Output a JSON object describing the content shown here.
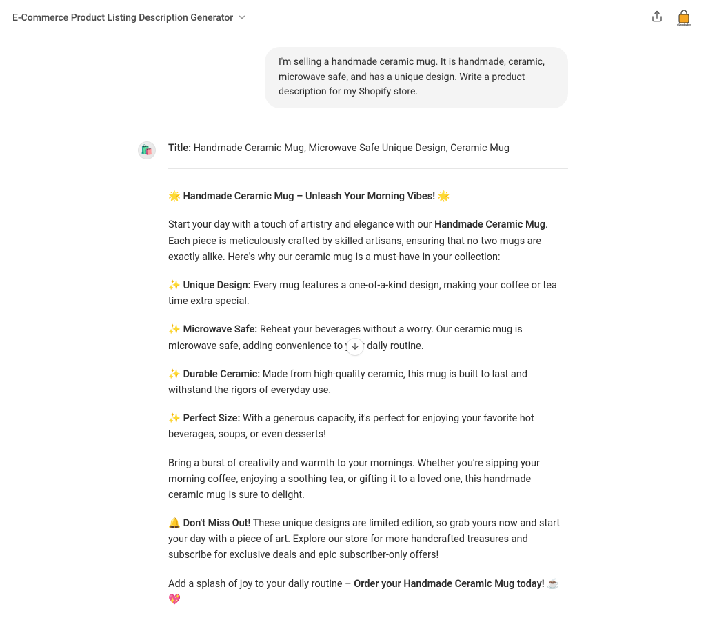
{
  "header": {
    "title": "E-Commerce Product Listing Description Generator",
    "integration_label": "eShopBuddy"
  },
  "user_message": "I'm selling a handmade ceramic mug. It is handmade, ceramic, microwave safe, and has a unique design. Write a product description for my Shopify store.",
  "assistant": {
    "title_label": "Title:",
    "title_value": "Handmade Ceramic Mug, Microwave Safe Unique Design, Ceramic Mug",
    "headline": "🌟 Handmade Ceramic Mug – Unleash Your Morning Vibes! 🌟",
    "intro_pre": "Start your day with a touch of artistry and elegance with our ",
    "intro_bold": "Handmade Ceramic Mug",
    "intro_post": ". Each piece is meticulously crafted by skilled artisans, ensuring that no two mugs are exactly alike. Here's why our ceramic mug is a must-have in your collection:",
    "feat1_label": "✨ Unique Design:",
    "feat1_text": " Every mug features a one-of-a-kind design, making your coffee or tea time extra special.",
    "feat2_label": "✨ Microwave Safe:",
    "feat2_text": " Reheat your beverages without a worry. Our ceramic mug is microwave safe, adding convenience to your daily routine.",
    "feat3_label": "✨ Durable Ceramic:",
    "feat3_text": " Made from high-quality ceramic, this mug is built to last and withstand the rigors of everyday use.",
    "feat4_label": "✨ Perfect Size:",
    "feat4_text": " With a generous capacity, it's perfect for enjoying your favorite hot beverages, soups, or even desserts!",
    "closing1": "Bring a burst of creativity and warmth to your mornings. Whether you're sipping your morning coffee, enjoying a soothing tea, or gifting it to a loved one, this handmade ceramic mug is sure to delight.",
    "miss_label": "🔔 Don't Miss Out!",
    "miss_text": " These unique designs are limited edition, so grab yours now and start your day with a piece of art. Explore our store for more handcrafted treasures and subscribe for exclusive deals and epic subscriber-only offers!",
    "cta_pre": "Add a splash of joy to your daily routine – ",
    "cta_bold": "Order your Handmade Ceramic Mug today!",
    "cta_post": " ☕💖"
  }
}
